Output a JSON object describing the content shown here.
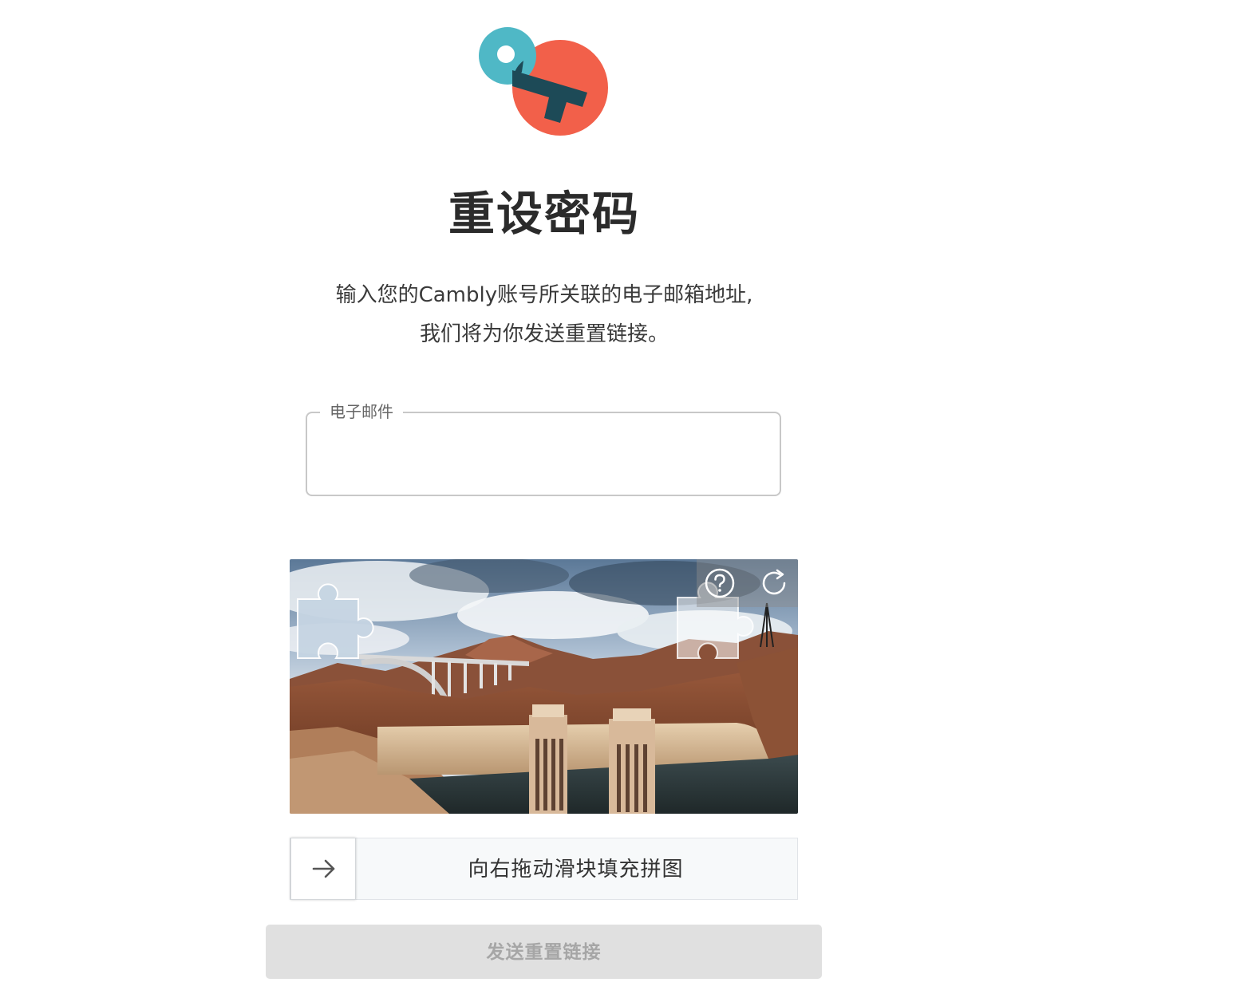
{
  "header": {
    "logo_icon": "key-icon",
    "title": "重设密码",
    "subtitle_line1": "输入您的Cambly账号所关联的电子邮箱地址,",
    "subtitle_line2": "我们将为你发送重置链接。"
  },
  "email_field": {
    "label": "电子邮件",
    "value": ""
  },
  "captcha": {
    "help_icon": "question-circle-icon",
    "refresh_icon": "refresh-icon",
    "slider_text": "向右拖动滑块填充拼图",
    "handle_icon": "arrow-right-icon"
  },
  "submit": {
    "label": "发送重置链接"
  },
  "colors": {
    "logo_teal": "#4fb8c6",
    "logo_coral": "#f2604a",
    "logo_dark": "#1d4a57",
    "button_disabled_bg": "#e0e0e0",
    "button_disabled_text": "#a6a6a6"
  }
}
